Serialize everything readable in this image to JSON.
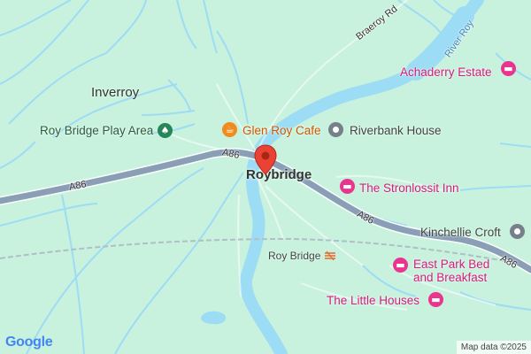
{
  "map": {
    "place_names": {
      "inverroy": "Inverroy",
      "roybridge": "Roybridge"
    },
    "roads": {
      "a86_west": "A86",
      "a86_center": "A86",
      "a86_mid": "A86",
      "a86_east": "A86",
      "braeroy_rd": "Braeroy Rd"
    },
    "water": {
      "river_roy": "River Roy"
    },
    "pois": {
      "glen_roy_cafe": "Glen Roy Cafe",
      "riverbank_house": "Riverbank House",
      "roy_bridge_play_area": "Roy Bridge Play Area",
      "achaderry_estate": "Achaderry Estate",
      "stronlossit_inn": "The Stronlossit Inn",
      "kinchellie_croft": "Kinchellie Croft",
      "east_park_line1": "East Park Bed",
      "east_park_line2": "and Breakfast",
      "little_houses": "The Little Houses"
    },
    "station": "Roy Bridge",
    "logo": "Google",
    "attribution": "Map data ©2025",
    "icons": {
      "poi_grey": "place-icon",
      "poi_green": "tree-icon",
      "poi_orange": "cafe-icon",
      "poi_pink": "hotel-icon",
      "station": "train-icon",
      "pin": "map-pin-icon"
    },
    "colors": {
      "land": "#c9f2de",
      "water": "#9ddcf5",
      "road": "#8a9fb5",
      "hotel": "#e9358e",
      "cafe": "#f18b1e",
      "park": "#26865a"
    }
  }
}
